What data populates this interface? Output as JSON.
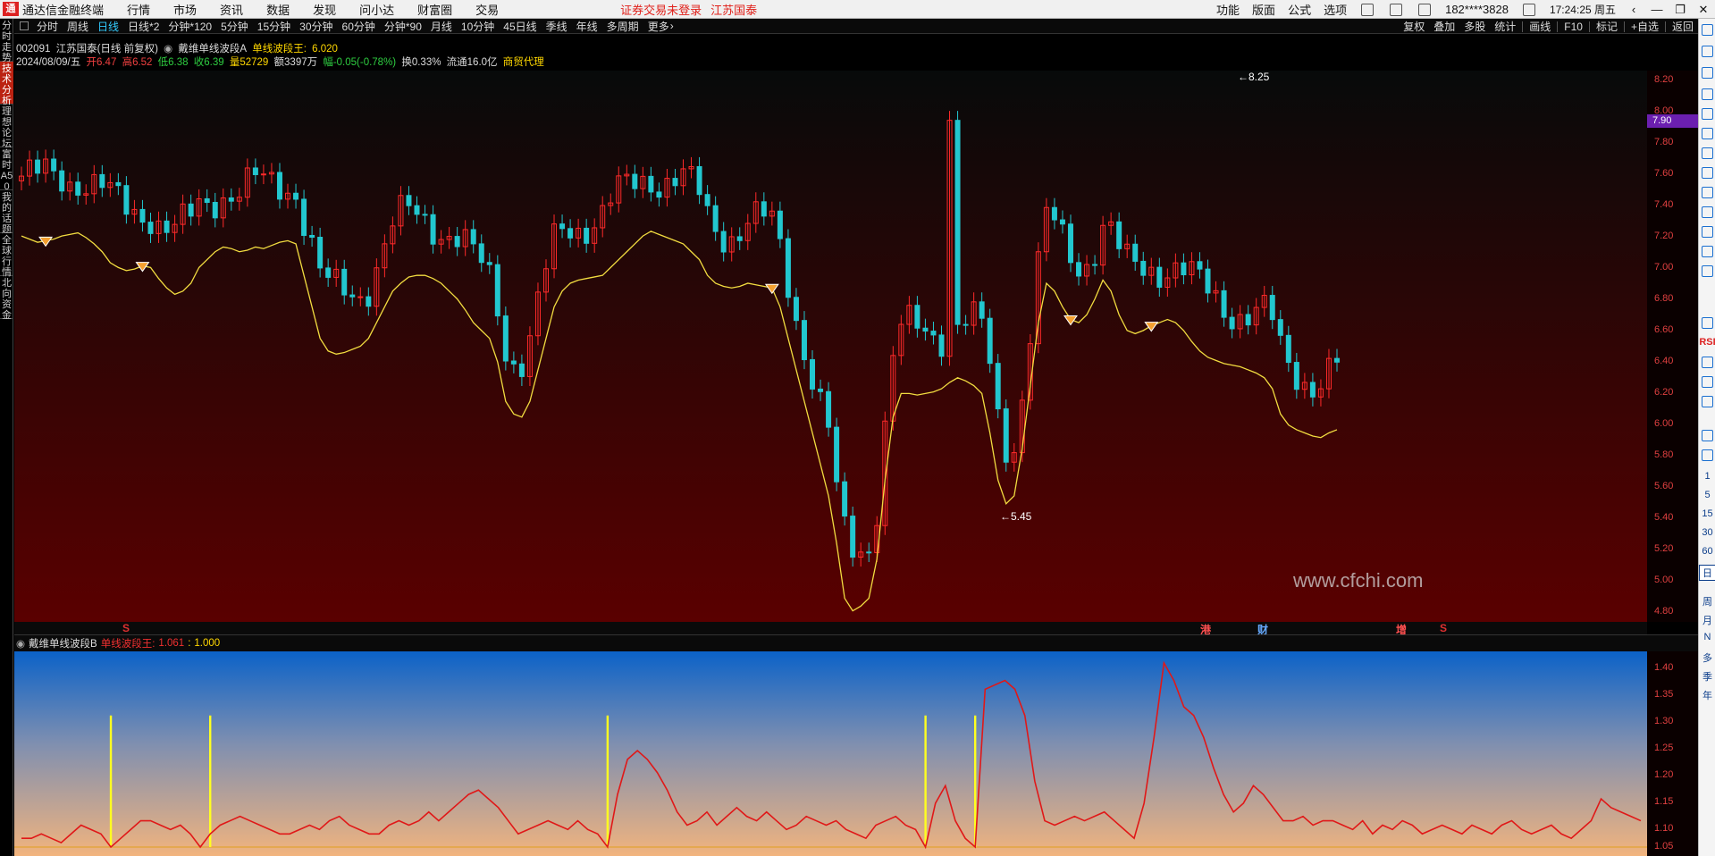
{
  "topbar": {
    "app_title": "通达信金融终端",
    "menus": [
      "行情",
      "市场",
      "资讯",
      "数据",
      "发现",
      "问小达",
      "财富圈",
      "交易"
    ],
    "warning": "证券交易未登录",
    "broker": "江苏国泰",
    "right_items": [
      "功能",
      "版面",
      "公式",
      "选项"
    ],
    "user": "182****3828",
    "clock": "17:24:25 周五"
  },
  "left_tabs": [
    "分时走势",
    "技术分析",
    "理想论坛",
    "富时A50",
    "我的话题",
    "全球行情",
    "北向资金"
  ],
  "period_bar": {
    "items": [
      "分时",
      "周线",
      "日线",
      "日线*2",
      "分钟*120",
      "5分钟",
      "15分钟",
      "30分钟",
      "60分钟",
      "分钟*90",
      "月线",
      "10分钟",
      "45日线",
      "季线",
      "年线",
      "多周期",
      "更多"
    ],
    "active": "日线",
    "right_items": [
      "复权",
      "叠加",
      "多股",
      "统计",
      "画线",
      "F10",
      "标记",
      "+自选",
      "返回"
    ]
  },
  "info_line1": {
    "code": "002091",
    "name": "江苏国泰(日线 前复权)",
    "indicator": "戴维单线波段A",
    "wave_label": "单线波段王:",
    "wave_value": "6.020"
  },
  "info_line2": {
    "date": "2024/08/09/五",
    "open_label": "开",
    "open": "6.47",
    "high_label": "高",
    "high": "6.52",
    "low_label": "低",
    "low": "6.38",
    "close_label": "收",
    "close": "6.39",
    "volume_label": "量",
    "volume": "52729",
    "amount_label": "额",
    "amount": "3397万",
    "change_label": "幅",
    "change": "-0.05(-0.78%)",
    "turnover_label": "换",
    "turnover": "0.33%",
    "float_label": "流通",
    "float": "16.0亿",
    "sector": "商贸代理"
  },
  "main_axis": {
    "ticks": [
      "8.20",
      "8.00",
      "7.80",
      "7.60",
      "7.40",
      "7.20",
      "7.00",
      "6.80",
      "6.60",
      "6.40",
      "6.20",
      "6.00",
      "5.80",
      "5.60",
      "5.40",
      "5.20",
      "5.00",
      "4.80"
    ],
    "current_price": "7.90"
  },
  "annotations": {
    "high": "8.25",
    "low": "5.45"
  },
  "watermark": "www.cfchi.com",
  "events": [
    {
      "label": "S",
      "color": "#e03030"
    },
    {
      "label": "港",
      "color": "#ff5050"
    },
    {
      "label": "财",
      "color": "#66aaff"
    },
    {
      "label": "增",
      "color": "#ff5050"
    },
    {
      "label": "S",
      "color": "#e03030"
    }
  ],
  "sub_indicator": {
    "name": "戴维单线波段B",
    "label": "单线波段王:",
    "v1": "1.061",
    "v2": "1.000",
    "ticks": [
      "1.40",
      "1.35",
      "1.30",
      "1.25",
      "1.20",
      "1.15",
      "1.10",
      "1.05"
    ]
  },
  "right_tools": {
    "labels": [
      "1",
      "5",
      "15",
      "30",
      "60",
      "日",
      "周",
      "月",
      "N",
      "多",
      "季",
      "年"
    ],
    "rsi": "RSI"
  },
  "chart_data": [
    {
      "type": "candlestick",
      "title": "江苏国泰(日线 前复权)",
      "ylim": [
        4.8,
        8.3
      ],
      "annotations": {
        "high": 8.25,
        "low": 5.45
      },
      "signal_marks": [
        3,
        15,
        93,
        130,
        140
      ],
      "wave_line": [
        7.25,
        7.23,
        7.21,
        7.22,
        7.23,
        7.25,
        7.26,
        7.27,
        7.24,
        7.2,
        7.15,
        7.08,
        7.05,
        7.03,
        7.04,
        7.06,
        7.05,
        6.98,
        6.92,
        6.88,
        6.9,
        6.95,
        7.05,
        7.1,
        7.15,
        7.18,
        7.17,
        7.15,
        7.16,
        7.18,
        7.17,
        7.19,
        7.21,
        7.22,
        7.2,
        7.0,
        6.8,
        6.6,
        6.52,
        6.5,
        6.51,
        6.53,
        6.55,
        6.6,
        6.7,
        6.8,
        6.9,
        6.95,
        6.99,
        7.0,
        7.0,
        6.98,
        6.95,
        6.9,
        6.85,
        6.78,
        6.7,
        6.65,
        6.6,
        6.45,
        6.2,
        6.12,
        6.1,
        6.2,
        6.4,
        6.6,
        6.8,
        6.9,
        6.95,
        6.97,
        6.98,
        6.99,
        7.0,
        7.05,
        7.1,
        7.15,
        7.2,
        7.25,
        7.28,
        7.26,
        7.24,
        7.22,
        7.2,
        7.15,
        7.1,
        7.0,
        6.95,
        6.93,
        6.92,
        6.93,
        6.95,
        6.94,
        6.93,
        6.92,
        6.8,
        6.6,
        6.4,
        6.2,
        6.0,
        5.8,
        5.6,
        5.3,
        4.95,
        4.87,
        4.9,
        4.95,
        5.2,
        5.7,
        6.1,
        6.25,
        6.25,
        6.24,
        6.25,
        6.26,
        6.28,
        6.32,
        6.35,
        6.33,
        6.3,
        6.25,
        6.0,
        5.7,
        5.55,
        5.6,
        5.9,
        6.3,
        6.7,
        6.95,
        6.9,
        6.8,
        6.72,
        6.7,
        6.75,
        6.85,
        6.97,
        6.9,
        6.75,
        6.65,
        6.63,
        6.65,
        6.68,
        6.7,
        6.72,
        6.7,
        6.65,
        6.58,
        6.52,
        6.48,
        6.46,
        6.44,
        6.43,
        6.42,
        6.4,
        6.38,
        6.35,
        6.28,
        6.12,
        6.05,
        6.02,
        6.0,
        5.98,
        5.97,
        6.0,
        6.02
      ]
    },
    {
      "type": "line",
      "title": "戴维单线波段B",
      "ylim": [
        1.0,
        1.43
      ],
      "signals": [
        9,
        19,
        59,
        91,
        96
      ],
      "series": [
        {
          "values": [
            1.02,
            1.02,
            1.03,
            1.02,
            1.01,
            1.03,
            1.05,
            1.04,
            1.03,
            1.0,
            1.02,
            1.04,
            1.06,
            1.06,
            1.05,
            1.04,
            1.05,
            1.03,
            1.0,
            1.03,
            1.05,
            1.06,
            1.07,
            1.06,
            1.05,
            1.04,
            1.03,
            1.03,
            1.04,
            1.05,
            1.04,
            1.06,
            1.07,
            1.05,
            1.04,
            1.03,
            1.03,
            1.05,
            1.06,
            1.05,
            1.06,
            1.08,
            1.06,
            1.08,
            1.1,
            1.12,
            1.13,
            1.11,
            1.09,
            1.06,
            1.03,
            1.04,
            1.05,
            1.06,
            1.05,
            1.04,
            1.06,
            1.04,
            1.03,
            1.0,
            1.12,
            1.2,
            1.22,
            1.2,
            1.17,
            1.13,
            1.08,
            1.05,
            1.06,
            1.08,
            1.05,
            1.07,
            1.09,
            1.07,
            1.06,
            1.08,
            1.06,
            1.04,
            1.05,
            1.07,
            1.06,
            1.05,
            1.06,
            1.04,
            1.03,
            1.02,
            1.05,
            1.06,
            1.07,
            1.05,
            1.04,
            1.0,
            1.1,
            1.14,
            1.06,
            1.02,
            1.0,
            1.36,
            1.37,
            1.38,
            1.36,
            1.3,
            1.15,
            1.06,
            1.05,
            1.06,
            1.07,
            1.06,
            1.07,
            1.08,
            1.06,
            1.04,
            1.02,
            1.1,
            1.25,
            1.42,
            1.38,
            1.32,
            1.3,
            1.25,
            1.18,
            1.12,
            1.08,
            1.1,
            1.14,
            1.12,
            1.09,
            1.06,
            1.06,
            1.07,
            1.05,
            1.06,
            1.06,
            1.05,
            1.04,
            1.06,
            1.03,
            1.05,
            1.04,
            1.06,
            1.05,
            1.03,
            1.04,
            1.05,
            1.04,
            1.03,
            1.05,
            1.04,
            1.03,
            1.05,
            1.06,
            1.04,
            1.03,
            1.04,
            1.05,
            1.03,
            1.02,
            1.04,
            1.06,
            1.11,
            1.09,
            1.08,
            1.07,
            1.06
          ]
        }
      ]
    }
  ]
}
